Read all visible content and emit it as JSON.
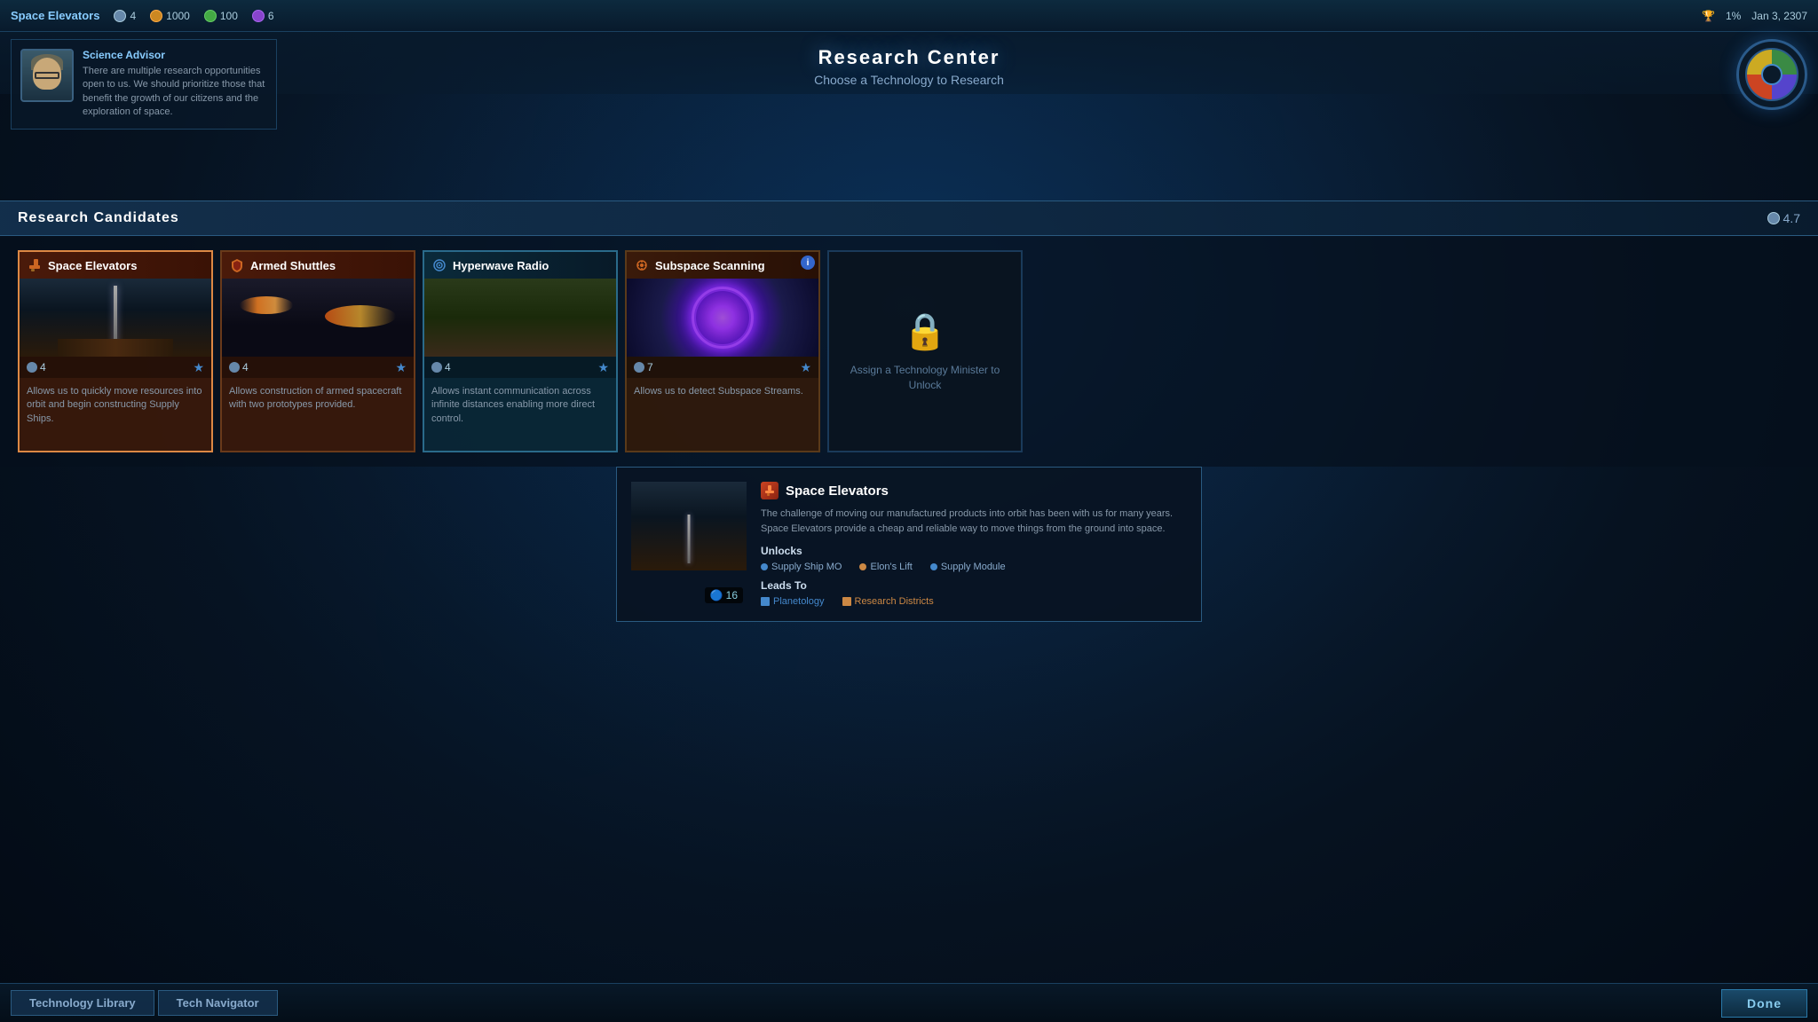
{
  "topbar": {
    "faction": "Space Elevators",
    "resources": [
      {
        "id": "research",
        "icon": "research-icon",
        "value": "4"
      },
      {
        "id": "production",
        "icon": "production-icon",
        "value": "1000"
      },
      {
        "id": "credits",
        "icon": "credits-icon",
        "value": "100"
      },
      {
        "id": "influence",
        "icon": "influence-icon",
        "value": "6"
      }
    ],
    "trophy_percent": "1%",
    "date": "Jan 3, 2307"
  },
  "header": {
    "title": "Research Center",
    "subtitle": "Choose a Technology to Research"
  },
  "advisor": {
    "name": "Science Advisor",
    "text": "There are multiple research opportunities open to us. We should prioritize those that benefit the growth of our citizens and the exploration of space."
  },
  "research_section": {
    "title": "Research Candidates",
    "stat_label": "4.7",
    "cards": [
      {
        "id": "space-elevators",
        "title": "Space Elevators",
        "cost": "4",
        "starred": true,
        "type": "orange",
        "description": "Allows us to quickly move resources into orbit and begin constructing Supply Ships.",
        "icon_type": "hammer"
      },
      {
        "id": "armed-shuttles",
        "title": "Armed Shuttles",
        "cost": "4",
        "starred": true,
        "type": "orange",
        "description": "Allows construction of armed spacecraft with two prototypes provided.",
        "icon_type": "shield"
      },
      {
        "id": "hyperwave-radio",
        "title": "Hyperwave Radio",
        "cost": "4",
        "starred": true,
        "type": "teal",
        "description": "Allows instant communication across infinite distances enabling more direct control.",
        "icon_type": "wave"
      },
      {
        "id": "subspace-scanning",
        "title": "Subspace Scanning",
        "cost": "7",
        "starred": true,
        "type": "brown",
        "description": "Allows us to detect Subspace Streams.",
        "icon_type": "scan",
        "has_badge": true
      },
      {
        "id": "locked",
        "title": "",
        "cost": "",
        "type": "locked",
        "description": "",
        "lock_text": "Assign a Technology Minister to Unlock"
      }
    ]
  },
  "detail": {
    "title": "Space Elevators",
    "description": "The challenge of moving our manufactured products into orbit has been with us for many years. Space Elevators provide a cheap and reliable way to move things from the ground into space.",
    "unlocks_title": "Unlocks",
    "unlocks": [
      {
        "name": "Supply Ship MO",
        "color": "blue"
      },
      {
        "name": "Elon's Lift",
        "color": "orange"
      },
      {
        "name": "Supply Module",
        "color": "blue"
      }
    ],
    "leads_to_title": "Leads To",
    "leads_to": [
      {
        "name": "Planetology",
        "color": "blue"
      },
      {
        "name": "Research Districts",
        "color": "orange"
      }
    ],
    "cost": "16"
  },
  "bottombar": {
    "tabs": [
      {
        "id": "technology-library",
        "label": "Technology Library"
      },
      {
        "id": "tech-navigator",
        "label": "Tech Navigator"
      }
    ],
    "done_label": "Done"
  }
}
